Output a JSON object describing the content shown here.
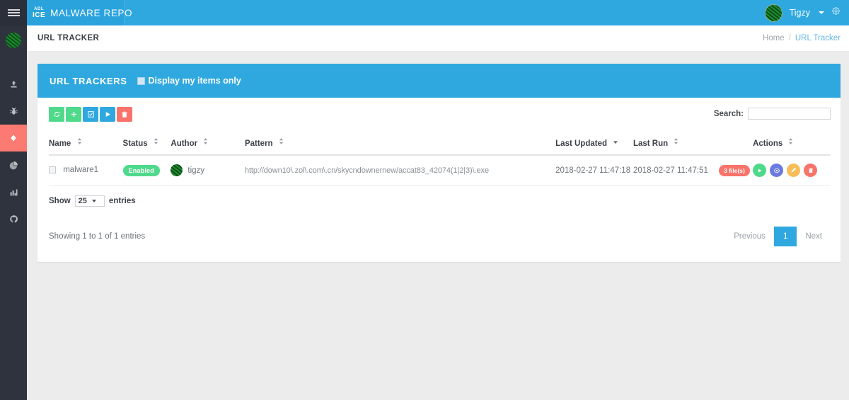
{
  "app": {
    "brand_adl": "ADL",
    "brand_ice": "ICE",
    "brand_name": "MALWARE REPO",
    "user_name": "Tigzy"
  },
  "icons": {
    "hamburger": "hamburger-icon",
    "gear": "gear-icon",
    "avatar": "avatar-icon"
  },
  "sidebar": {
    "items": [
      {
        "name": "upload",
        "label": "Upload",
        "active": false
      },
      {
        "name": "bug",
        "label": "Malware",
        "active": false
      },
      {
        "name": "url-tracker",
        "label": "URL Tracker",
        "active": true
      },
      {
        "name": "pie-chart",
        "label": "Statistics",
        "active": false
      },
      {
        "name": "bar-chart",
        "label": "Reports",
        "active": false
      },
      {
        "name": "github",
        "label": "Source",
        "active": false
      }
    ]
  },
  "page": {
    "title": "URL TRACKER",
    "breadcrumb": {
      "home": "Home",
      "separator": "/",
      "current": "URL Tracker"
    }
  },
  "card": {
    "title": "URL TRACKERS",
    "my_items_label": "Display my items only",
    "my_items_checked": false
  },
  "toolbar": {
    "buttons": [
      {
        "name": "refresh-button",
        "icon": "refresh-icon",
        "color": "#4fd98b"
      },
      {
        "name": "add-button",
        "icon": "plus-icon",
        "color": "#4fd98b"
      },
      {
        "name": "edit-button",
        "icon": "checkbox-edit-icon",
        "color": "#2fa8e0"
      },
      {
        "name": "run-button",
        "icon": "play-icon",
        "color": "#2fa8e0"
      },
      {
        "name": "delete-button",
        "icon": "trash-icon",
        "color": "#f8736a"
      }
    ]
  },
  "search": {
    "label": "Search:",
    "value": "",
    "placeholder": ""
  },
  "table": {
    "columns": [
      {
        "label": "Name",
        "sort": "none"
      },
      {
        "label": "Status",
        "sort": "none"
      },
      {
        "label": "Author",
        "sort": "none"
      },
      {
        "label": "Pattern",
        "sort": "none"
      },
      {
        "label": "Last Updated",
        "sort": "desc"
      },
      {
        "label": "Last Run",
        "sort": "none"
      },
      {
        "label": "Actions",
        "sort": "none"
      }
    ],
    "rows": [
      {
        "name": "malware1",
        "status": "Enabled",
        "author": "tigzy",
        "pattern": "http://down10\\.zol\\.com\\.cn/skycndownernew/accat83_42074(1|2|3)\\.exe",
        "last_updated": "2018-02-27 11:47:18",
        "last_run": "2018-02-27 11:47:51",
        "files_badge": "3 file(s)",
        "actions": [
          {
            "name": "row-run-button",
            "icon": "play-icon",
            "color": "#4fd98b"
          },
          {
            "name": "row-view-button",
            "icon": "eye-icon",
            "color": "#6a7ae0"
          },
          {
            "name": "row-edit-button",
            "icon": "pencil-icon",
            "color": "#f8bd56"
          },
          {
            "name": "row-delete-button",
            "icon": "trash-icon",
            "color": "#f8736a"
          }
        ]
      }
    ]
  },
  "footer": {
    "show_label": "Show",
    "entries_value": "25",
    "entries_label": "entries",
    "showing_text": "Showing 1 to 1 of 1 entries",
    "pagination": {
      "previous": "Previous",
      "pages": [
        "1"
      ],
      "next": "Next"
    }
  },
  "colors": {
    "brand_blue": "#2fa8e0",
    "sidebar_dark": "#2f333e",
    "accent_red": "#fb7a72",
    "success_green": "#4fd98b",
    "page_bg": "#ececec"
  }
}
